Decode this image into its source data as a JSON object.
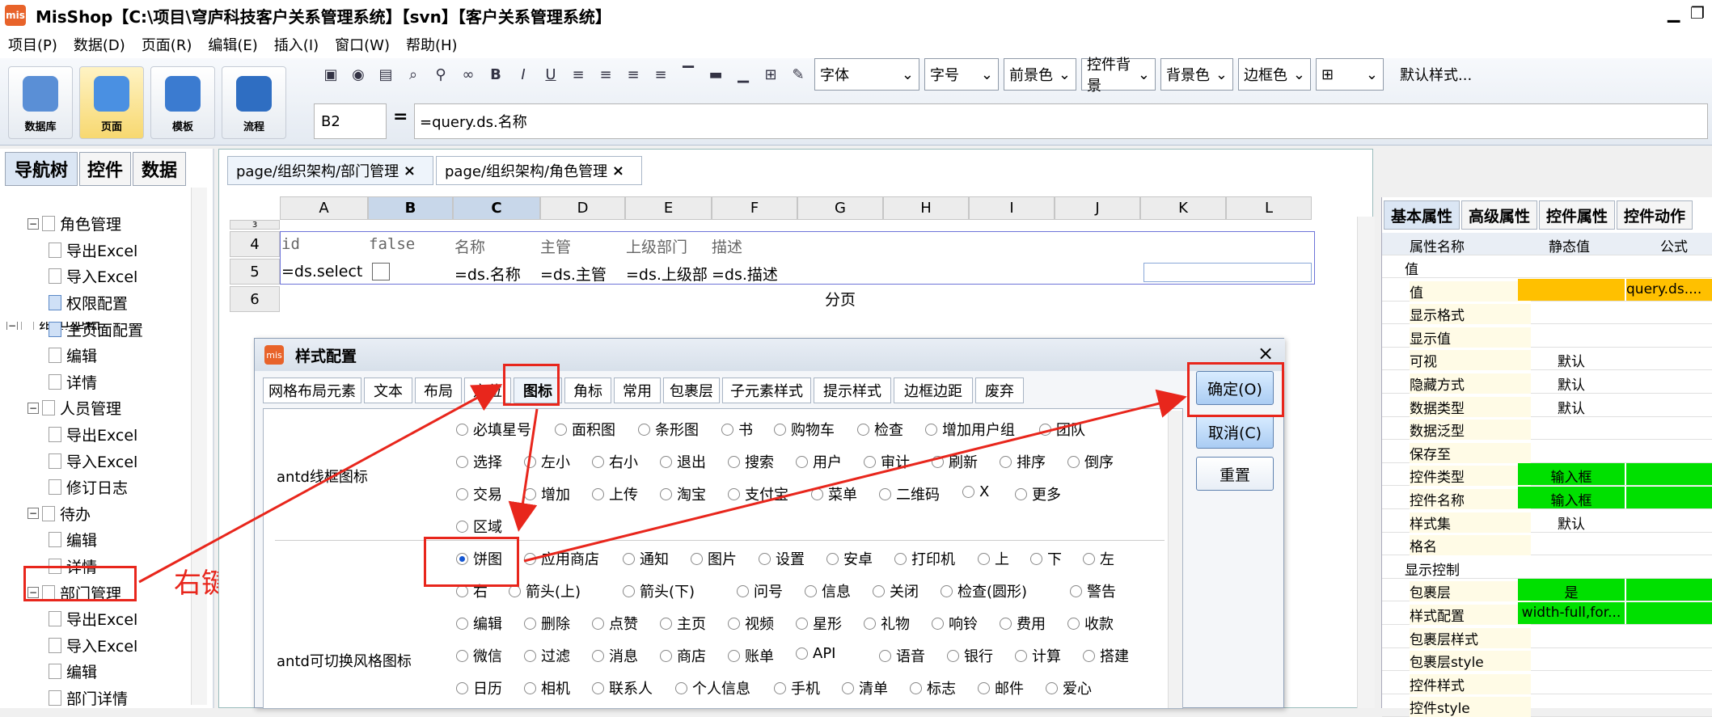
{
  "window": {
    "title": "MisShop【C:\\项目\\穹庐科技客户关系管理系统】【svn】【客户关系管理系统】",
    "app_icon": "mis",
    "minimize": "▁",
    "restore": "❐"
  },
  "menu": [
    "项目(P)",
    "数据(D)",
    "页面(R)",
    "编辑(E)",
    "插入(I)",
    "窗口(W)",
    "帮助(H)"
  ],
  "big_buttons": [
    "数据库",
    "页面",
    "模板",
    "流程"
  ],
  "format": {
    "font_placeholder": "字体",
    "size_placeholder": "字号",
    "front_color": "前景色",
    "control_bg": "控件背景",
    "back_color": "背景色",
    "border_color": "边框色",
    "default_style": "默认样式..."
  },
  "formula": {
    "cell_ref": "B2",
    "eq": "=",
    "value": "=query.ds.名称"
  },
  "left_tabs": [
    "导航树",
    "控件",
    "数据"
  ],
  "tree": [
    {
      "label": "组织架构",
      "level": 0,
      "kind": "folder"
    },
    {
      "label": "角色管理",
      "level": 1,
      "kind": "folder"
    },
    {
      "label": "导出Excel",
      "level": 2,
      "kind": "file"
    },
    {
      "label": "导入Excel",
      "level": 2,
      "kind": "file"
    },
    {
      "label": "权限配置",
      "level": 2,
      "kind": "blue"
    },
    {
      "label": "主页面配置",
      "level": 2,
      "kind": "blue"
    },
    {
      "label": "编辑",
      "level": 2,
      "kind": "file"
    },
    {
      "label": "详情",
      "level": 2,
      "kind": "file"
    },
    {
      "label": "人员管理",
      "level": 1,
      "kind": "folder"
    },
    {
      "label": "导出Excel",
      "level": 2,
      "kind": "file"
    },
    {
      "label": "导入Excel",
      "level": 2,
      "kind": "file"
    },
    {
      "label": "修订日志",
      "level": 2,
      "kind": "file"
    },
    {
      "label": "待办",
      "level": 1,
      "kind": "folder"
    },
    {
      "label": "编辑",
      "level": 2,
      "kind": "file"
    },
    {
      "label": "详情",
      "level": 2,
      "kind": "file"
    },
    {
      "label": "部门管理",
      "level": 1,
      "kind": "folder"
    },
    {
      "label": "导出Excel",
      "level": 2,
      "kind": "file"
    },
    {
      "label": "导入Excel",
      "level": 2,
      "kind": "file"
    },
    {
      "label": "编辑",
      "level": 2,
      "kind": "file"
    },
    {
      "label": "部门详情",
      "level": 2,
      "kind": "file"
    }
  ],
  "annotation": "右键-->样式配置",
  "doc_tabs": [
    "page/组织架构/部门管理",
    "page/组织架构/角色管理"
  ],
  "tab_close": "×",
  "columns": [
    "A",
    "B",
    "C",
    "D",
    "E",
    "F",
    "G",
    "H",
    "I",
    "J",
    "K",
    "L"
  ],
  "rows": [
    "3",
    "4",
    "5",
    "6"
  ],
  "row4": [
    "id",
    "false",
    "名称",
    "主管",
    "上级部门",
    "描述"
  ],
  "row5": [
    "=ds.select",
    "",
    "=ds.名称",
    "=ds.主管",
    "=ds.上级部",
    "=ds.描述"
  ],
  "row6_center": "分页",
  "right_tabs": [
    "基本属性",
    "高级属性",
    "控件属性",
    "控件动作"
  ],
  "prop_headers": [
    "属性名称",
    "静态值",
    "公式"
  ],
  "props": [
    {
      "name": "值",
      "static": "",
      "formula": "",
      "group": true
    },
    {
      "name": "值",
      "static": "",
      "formula": "query.ds....",
      "hl": "orange"
    },
    {
      "name": "显示格式",
      "static": "",
      "formula": ""
    },
    {
      "name": "显示值",
      "static": "",
      "formula": ""
    },
    {
      "name": "可视",
      "static": "默认",
      "formula": ""
    },
    {
      "name": "隐藏方式",
      "static": "默认",
      "formula": ""
    },
    {
      "name": "数据类型",
      "static": "默认",
      "formula": ""
    },
    {
      "name": "数据泛型",
      "static": "",
      "formula": ""
    },
    {
      "name": "保存至",
      "static": "",
      "formula": ""
    },
    {
      "name": "控件类型",
      "static": "输入框",
      "formula": "",
      "hl": "green"
    },
    {
      "name": "控件名称",
      "static": "输入框",
      "formula": "",
      "hl": "green"
    },
    {
      "name": "样式集",
      "static": "默认",
      "formula": ""
    },
    {
      "name": "格名",
      "static": "",
      "formula": ""
    },
    {
      "name": "显示控制",
      "static": "",
      "formula": "",
      "group": true
    },
    {
      "name": "包裹层",
      "static": "是",
      "formula": "",
      "hl": "green"
    },
    {
      "name": "样式配置",
      "static": "width-full,for...",
      "formula": "",
      "hl": "green"
    },
    {
      "name": "包裹层样式",
      "static": "",
      "formula": ""
    },
    {
      "name": "包裹层style",
      "static": "",
      "formula": ""
    },
    {
      "name": "控件样式",
      "static": "",
      "formula": ""
    },
    {
      "name": "控件style",
      "static": "",
      "formula": ""
    }
  ],
  "dialog": {
    "title": "样式配置",
    "close": "×",
    "tabs": [
      "网格布局元素",
      "文本",
      "布局",
      "定位",
      "图标",
      "角标",
      "常用",
      "包裹层",
      "子元素样式",
      "提示样式",
      "边框边距",
      "废弃"
    ],
    "ok": "确定(O)",
    "cancel": "取消(C)",
    "reset": "重置",
    "group1": "antd线框图标",
    "group2": "antd可切换风格图标",
    "g1_row1": [
      "必填星号",
      "面积图",
      "条形图",
      "书",
      "购物车",
      "检查",
      "增加用户组",
      "团队"
    ],
    "g1_row2": [
      "选择",
      "左小",
      "右小",
      "退出",
      "搜索",
      "用户",
      "审计",
      "刷新",
      "排序",
      "倒序"
    ],
    "g1_row3": [
      "交易",
      "增加",
      "上传",
      "淘宝",
      "支付宝",
      "菜单",
      "二维码",
      "X",
      "更多"
    ],
    "g1_row4": [
      "区域"
    ],
    "g2_row1": [
      "饼图",
      "应用商店",
      "通知",
      "图片",
      "设置",
      "安卓",
      "打印机",
      "上",
      "下",
      "左"
    ],
    "g2_row2": [
      "右",
      "箭头(上)",
      "箭头(下)",
      "问号",
      "信息",
      "关闭",
      "检查(圆形)",
      "警告"
    ],
    "g2_row3": [
      "编辑",
      "删除",
      "点赞",
      "主页",
      "视频",
      "星形",
      "礼物",
      "响铃",
      "费用",
      "收款"
    ],
    "g2_row4": [
      "微信",
      "过滤",
      "消息",
      "商店",
      "账单",
      "API",
      "语音",
      "银行",
      "计算",
      "搭建"
    ],
    "g2_row5": [
      "日历",
      "相机",
      "联系人",
      "个人信息",
      "手机",
      "清单",
      "标志",
      "邮件",
      "爱心"
    ]
  },
  "colors": {
    "red": "#e8261c",
    "green": "#00e000",
    "orange": "#ffc000",
    "prop_name_bg": "#fffbe6"
  }
}
